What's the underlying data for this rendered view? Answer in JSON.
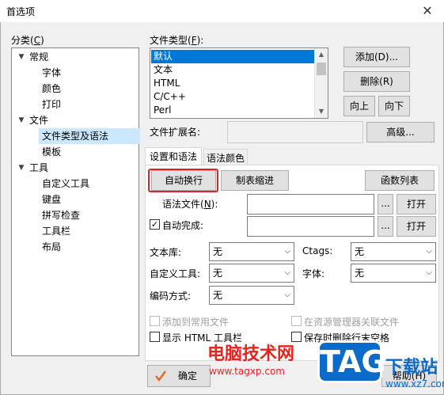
{
  "window": {
    "title": "首选项",
    "close_glyph": "✕"
  },
  "category": {
    "label": "分类(",
    "label_key": "C",
    "label_end": ")",
    "items": [
      {
        "label": "常规",
        "expander": "▼"
      },
      {
        "label": "字体"
      },
      {
        "label": "颜色"
      },
      {
        "label": "打印"
      },
      {
        "label": "文件",
        "expander": "▼"
      },
      {
        "label": "文件类型及语法",
        "selected": true
      },
      {
        "label": "模板"
      },
      {
        "label": "工具",
        "expander": "▼"
      },
      {
        "label": "自定义工具"
      },
      {
        "label": "键盘"
      },
      {
        "label": "拼写检查"
      },
      {
        "label": "工具栏"
      },
      {
        "label": "布局"
      }
    ]
  },
  "filetypes": {
    "label": "文件类型(",
    "label_key": "F",
    "label_end": "):",
    "items": [
      "默认",
      "文本",
      "HTML",
      "C/C++",
      "Perl"
    ],
    "selected": "默认",
    "scroll_up": "▲",
    "scroll_down": "▼"
  },
  "buttons": {
    "add": "添加(D)...",
    "remove": "删除(R)",
    "up": "向上",
    "down": "向下",
    "advanced": "高级...",
    "ok": "确定",
    "help": "帮助(H)"
  },
  "extension": {
    "label": "文件扩展名:",
    "value": ""
  },
  "tabs": [
    {
      "label": "设置和语法",
      "active": true
    },
    {
      "label": "语法颜色",
      "active": false
    }
  ],
  "settings": {
    "wrap_button": "自动换行",
    "tab_indent_button": "制表缩进",
    "function_list_button": "函数列表",
    "syntax_file_label": "语法文件(",
    "syntax_file_key": "N",
    "syntax_file_end": "):",
    "syntax_file_value": "",
    "autocomplete_label": "自动完成:",
    "autocomplete_checked": true,
    "autocomplete_value": "",
    "browse_label": "...",
    "open_label": "打开",
    "check_mark": "✓",
    "library_label": "文本库:",
    "library_value": "无",
    "ctags_label": "Ctags:",
    "ctags_value": "无",
    "custom_tool_label": "自定义工具:",
    "custom_tool_value": "无",
    "font_label": "字体:",
    "font_value": "无",
    "encoding_label": "编码方式:",
    "encoding_value": "无",
    "combo_arrow": "⌵",
    "add_to_common": "添加到常用文件",
    "associate_explorer": "在资源管理器关联文件",
    "show_html_toolbar": "显示 HTML 工具栏",
    "trim_on_save": "保存时删除行末空格"
  },
  "watermarks": {
    "site_name": "电脑技术网",
    "site_url": "www.tagxp.com",
    "tag_logo": "TAG",
    "tag_title": "下载站",
    "tag_url": "www.xz7.com"
  },
  "colors": {
    "highlight_box": "#e0232a",
    "selection": "#0078d7",
    "tree_selection": "#cce8ff",
    "ok_check": "#e86a1a"
  }
}
